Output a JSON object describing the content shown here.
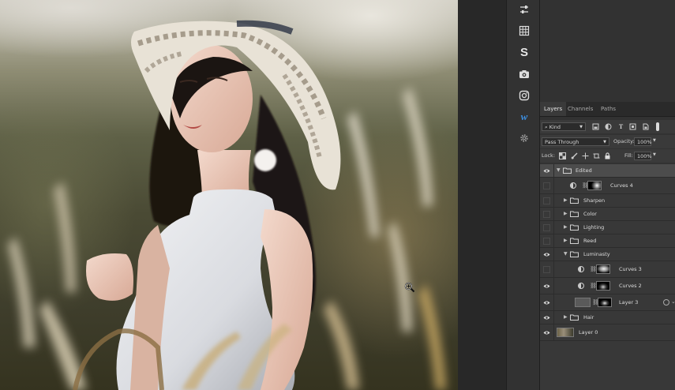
{
  "panels": {
    "tabs": [
      {
        "label": "Layers",
        "active": true
      },
      {
        "label": "Channels",
        "active": false
      },
      {
        "label": "Paths",
        "active": false
      }
    ]
  },
  "filter": {
    "kind_label": "Kind"
  },
  "blend": {
    "mode": "Pass Through",
    "opacity_label": "Opacity:",
    "opacity_value": "100%"
  },
  "lock": {
    "lock_label": "Lock:",
    "fill_label": "Fill:",
    "fill_value": "100%"
  },
  "toolstrip": {
    "icons": [
      "adjust-sliders-icon",
      "grid-icon",
      "stock-s-icon",
      "camera-icon",
      "instagram-icon",
      "w-logo-icon",
      "gear-icon"
    ]
  },
  "layers": [
    {
      "name": "Edited",
      "type": "group",
      "expanded": true,
      "visible": true,
      "selected": true,
      "depth": 0
    },
    {
      "name": "Curves 4",
      "type": "adjustment",
      "visible": false,
      "depth": 1
    },
    {
      "name": "Sharpen",
      "type": "group",
      "expanded": false,
      "visible": false,
      "depth": 1
    },
    {
      "name": "Color",
      "type": "group",
      "expanded": false,
      "visible": false,
      "depth": 1
    },
    {
      "name": "Lighting",
      "type": "group",
      "expanded": false,
      "visible": false,
      "depth": 1
    },
    {
      "name": "Reed",
      "type": "group",
      "expanded": false,
      "visible": false,
      "depth": 1
    },
    {
      "name": "Luminasty",
      "type": "group",
      "expanded": true,
      "visible": true,
      "depth": 1
    },
    {
      "name": "Curves 3",
      "type": "adjustment",
      "visible": false,
      "depth": 2
    },
    {
      "name": "Curves 2",
      "type": "adjustment",
      "visible": true,
      "depth": 2
    },
    {
      "name": "Layer 3",
      "type": "pixel",
      "visible": true,
      "depth": 2
    },
    {
      "name": "Hair",
      "type": "group",
      "expanded": false,
      "visible": true,
      "depth": 1
    },
    {
      "name": "Layer 0",
      "type": "pixel",
      "visible": true,
      "depth": 0
    }
  ],
  "colors": {
    "accent_blue": "#3d8fe0",
    "panel_bg": "#323232",
    "layers_bg": "#383838",
    "selected_row": "#4c4c4c"
  }
}
